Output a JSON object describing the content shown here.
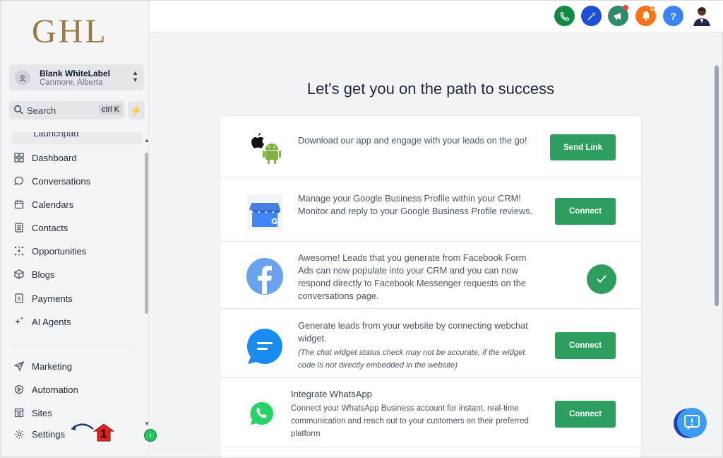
{
  "logo": "GHL",
  "account": {
    "name": "Blank WhiteLabel",
    "location": "Canmore, Alberta"
  },
  "search": {
    "label": "Search",
    "shortcut": "ctrl K"
  },
  "sidebar": {
    "partial_item": "Launchpad",
    "items": [
      {
        "label": "Dashboard",
        "icon": "grid-icon"
      },
      {
        "label": "Conversations",
        "icon": "chat-bubble-icon"
      },
      {
        "label": "Calendars",
        "icon": "calendar-icon"
      },
      {
        "label": "Contacts",
        "icon": "contacts-icon"
      },
      {
        "label": "Opportunities",
        "icon": "opportunities-icon"
      },
      {
        "label": "Blogs",
        "icon": "cube-icon"
      },
      {
        "label": "Payments",
        "icon": "dollar-icon"
      },
      {
        "label": "AI Agents",
        "icon": "sparkle-icon"
      }
    ],
    "bottom_items": [
      {
        "label": "Marketing",
        "icon": "send-icon"
      },
      {
        "label": "Automation",
        "icon": "automation-icon"
      },
      {
        "label": "Sites",
        "icon": "sites-icon"
      },
      {
        "label": "Settings",
        "icon": "gear-icon"
      }
    ],
    "annotation_number": "1"
  },
  "topbar": {
    "buttons": [
      {
        "name": "phone-icon",
        "color": "#16a34a"
      },
      {
        "name": "magic-wand-icon",
        "color": "#2563eb"
      },
      {
        "name": "megaphone-icon",
        "color": "#0f9d58"
      },
      {
        "name": "bell-icon",
        "color": "#f97316"
      },
      {
        "name": "help-icon",
        "label": "?",
        "color": "#3b82f6"
      }
    ]
  },
  "main": {
    "title": "Let's get you on the path to success",
    "rows": [
      {
        "text": "Download our app and engage with your leads on the go!",
        "button": "Send Link"
      },
      {
        "text": "Manage your Google Business Profile within your CRM! Monitor and reply to your Google Business Profile reviews.",
        "button": "Connect"
      },
      {
        "text": "Awesome! Leads that you generate from Facebook Form Ads can now populate into your CRM and you can now respond directly to Facebook Messenger requests on the conversations page.",
        "status": "connected"
      },
      {
        "text": "Generate leads from your website by connecting webchat widget.",
        "note": "(The chat widget status check may not be accurate, if the widget code is not directly embedded in the website)",
        "button": "Connect"
      },
      {
        "title": "Integrate WhatsApp",
        "text": "Connect your WhatsApp Business account for instant, real-time communication and reach out to your customers on their preferred platform",
        "button": "Connect"
      }
    ]
  },
  "colors": {
    "accent_green": "#2e9e5f",
    "logo_gold": "#9b7a45"
  }
}
